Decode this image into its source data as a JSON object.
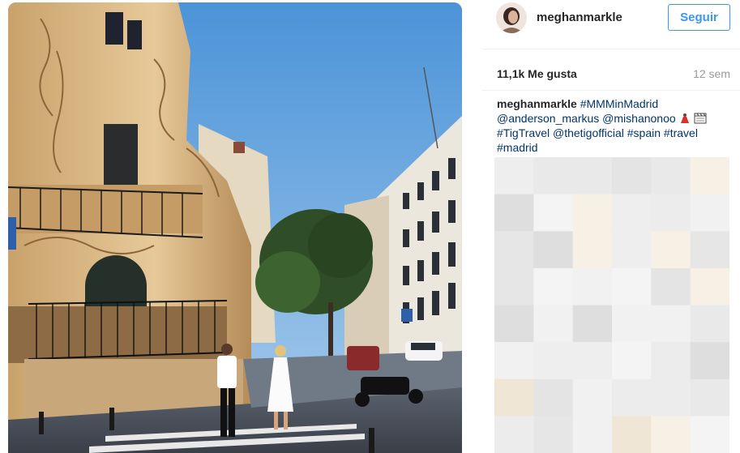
{
  "post": {
    "username": "meghanmarkle",
    "follow_label": "Seguir",
    "likes": "11,1k Me gusta",
    "time_ago": "12 sem"
  },
  "caption": {
    "username": "meghanmarkle",
    "hashtag_main": "#MMMinMadrid",
    "mention_1": "@anderson_markus",
    "mention_2": "@mishanonoo",
    "hashtag_tig": "#TigTravel",
    "mention_3": "@thetigofficial",
    "hashtag_spain": "#spain",
    "hashtag_travel": "#travel",
    "hashtag_madrid": "#madrid",
    "emojis": [
      "dancer-emoji",
      "clapperboard-emoji"
    ]
  },
  "icons": {
    "avatar": "profile-photo",
    "photo": "madrid-street-photo",
    "comments_blurred": "pixelated-comments"
  },
  "colors": {
    "link": "#003569",
    "follow": "#3897f0",
    "muted": "#999999",
    "text": "#262626"
  }
}
